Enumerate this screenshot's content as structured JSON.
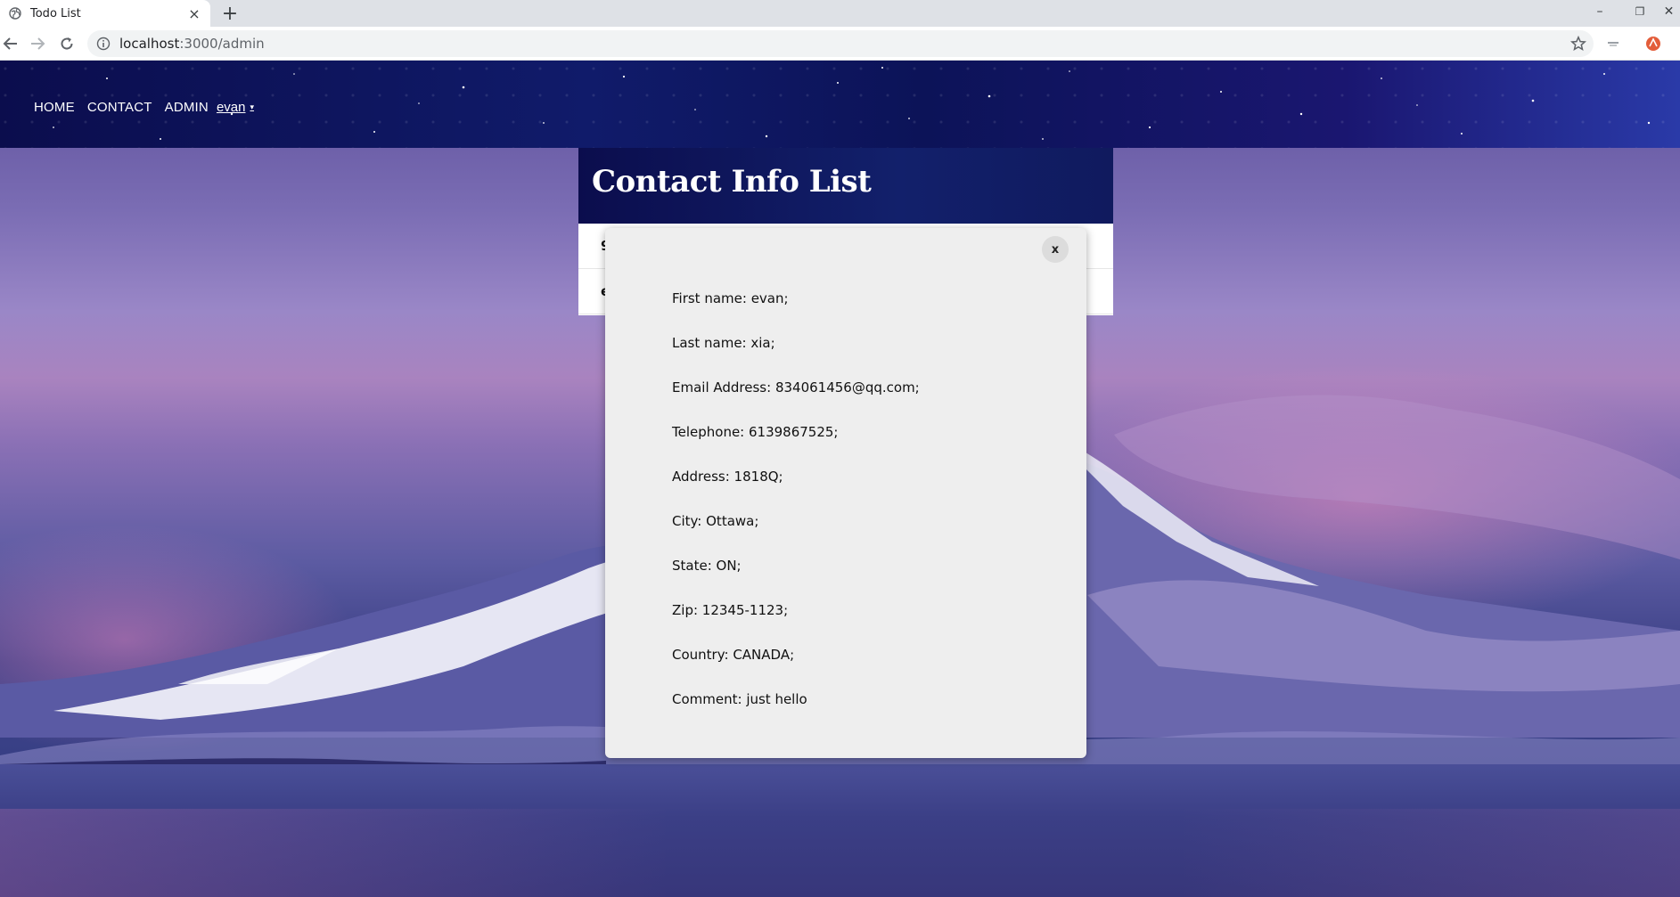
{
  "browser": {
    "tab_title": "Todo List",
    "tab_close": "×",
    "new_tab": "+",
    "url_host": "localhost",
    "url_path": ":3000/admin",
    "window_minimize": "–",
    "window_restore": "❐",
    "window_close": "✕"
  },
  "navbar": {
    "links": [
      "HOME",
      "CONTACT",
      "ADMIN"
    ],
    "user": "evan",
    "caret": "▾"
  },
  "panel": {
    "title": "Contact Info List",
    "rows": [
      "9",
      "e"
    ]
  },
  "modal": {
    "close_label": "x",
    "lines": [
      "First name: evan;",
      "Last name: xia;",
      "Email Address: 834061456@qq.com;",
      "Telephone: 6139867525;",
      "Address: 1818Q;",
      "City: Ottawa;",
      "State: ON;",
      "Zip: 12345-1123;",
      "Country: CANADA;",
      "Comment: just hello"
    ]
  },
  "colors": {
    "navbar": "#0c1358",
    "modal_bg": "#eeeeee"
  }
}
